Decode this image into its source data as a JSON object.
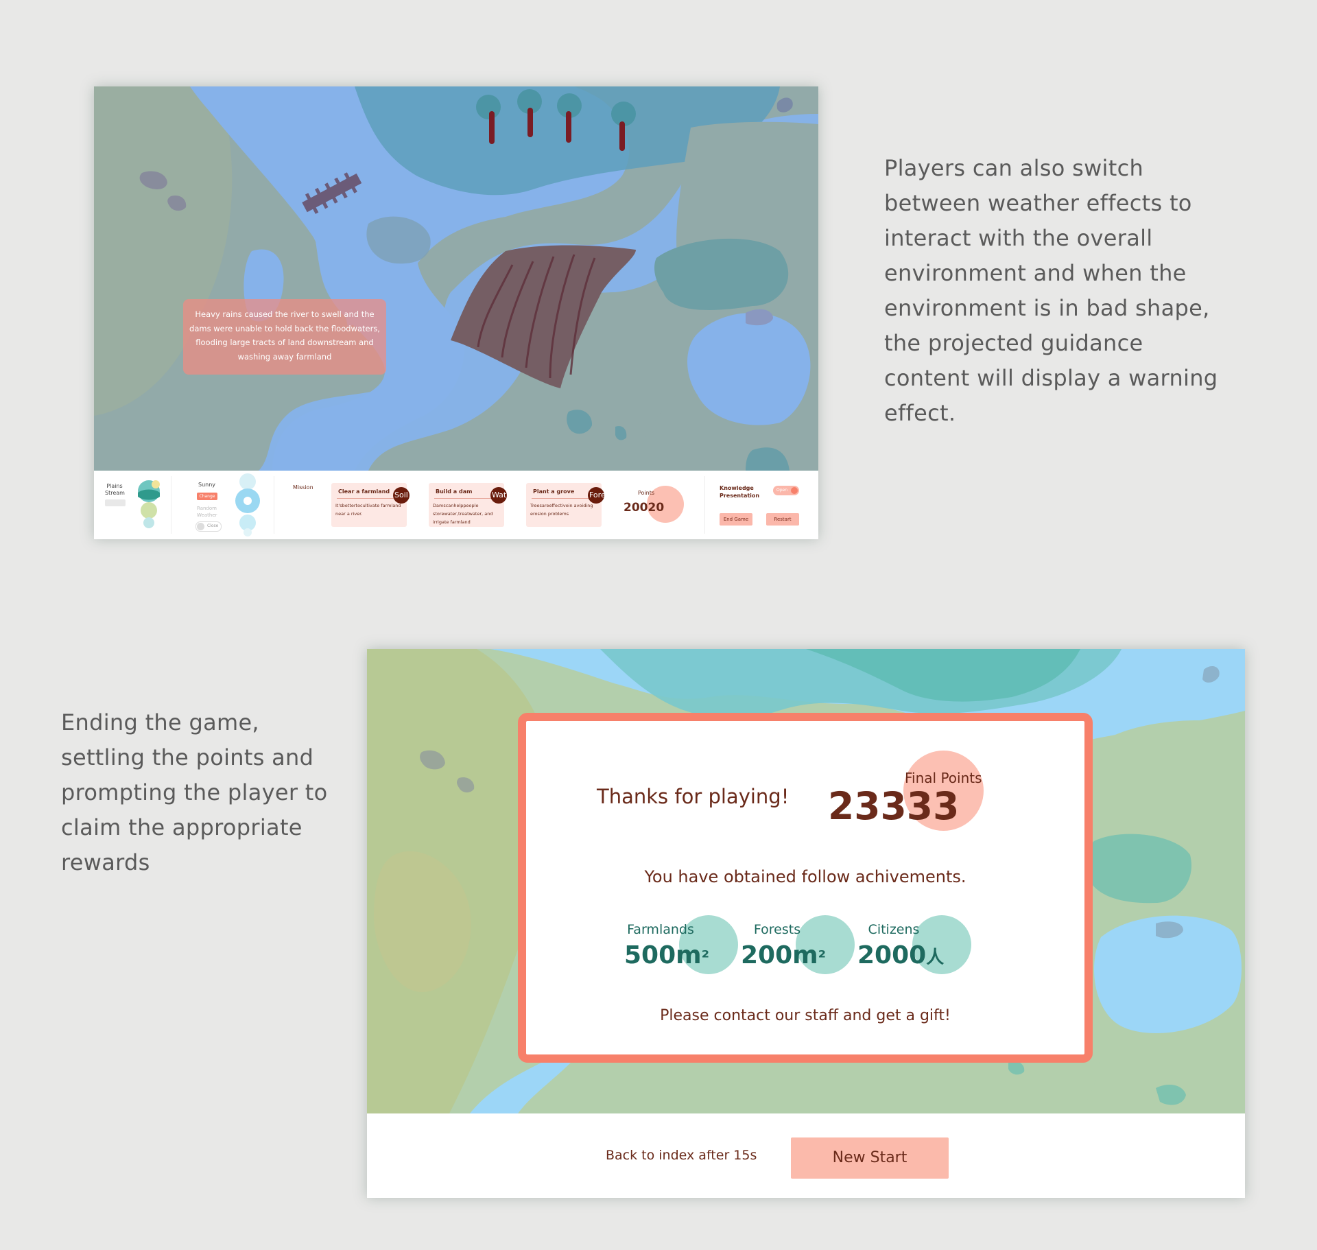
{
  "descriptions": {
    "top": "Players can also switch between weather effects to interact with the overall environment and when the environment is in bad shape, the projected guidance content will display a warning effect.",
    "bottom": "Ending the game, settling the points and prompting the player to claim the appropriate rewards"
  },
  "screen1": {
    "warning": "Heavy rains caused the river to swell and the dams were unable to hold back the floodwaters, flooding large tracts of land downstream and washing away farmland",
    "terrain": {
      "line1": "Plains",
      "line2": "Stream"
    },
    "weather": {
      "label": "Sunny",
      "change_label": "Change",
      "random_label": "Random Weather",
      "close_label": "Close"
    },
    "mission_label": "Mission",
    "missions": [
      {
        "title": "Clear a farmland",
        "desc": "It'sbettertocultivate farmland near a river.",
        "badge": "Soil"
      },
      {
        "title": "Build a dam",
        "desc": "Damscanhelppeople storewater,treatwater, and irrigate farmland",
        "badge": "Water"
      },
      {
        "title": "Plant a grove",
        "desc": "Treesareeffectivein avoiding erosion problems",
        "badge": "Forest"
      }
    ],
    "points_label": "Points",
    "points_value": "20020",
    "knowledge": {
      "line1": "Knowledge",
      "line2": "Presentation",
      "toggle_label": "Open"
    },
    "end_game_label": "End Game",
    "restart_label": "Restart"
  },
  "screen2": {
    "thanks": "Thanks for playing!",
    "final_label": "Final Points",
    "final_points": "23333",
    "achievements_text": "You have obtained follow achivements.",
    "achievements": [
      {
        "label": "Farmlands",
        "value": "500m",
        "unit": "²"
      },
      {
        "label": "Forests",
        "value": "200m",
        "unit": "²"
      },
      {
        "label": "Citizens",
        "value": "2000",
        "unit": "人"
      }
    ],
    "gift_text": "Please contact our staff and get a gift!",
    "back_text": "Back to index after 15s",
    "new_start_label": "New Start"
  },
  "colors": {
    "background": "#e8e8e7",
    "accent": "#f7806a",
    "text_brown": "#6a2a1a",
    "teal_text": "#1e6a5f"
  }
}
